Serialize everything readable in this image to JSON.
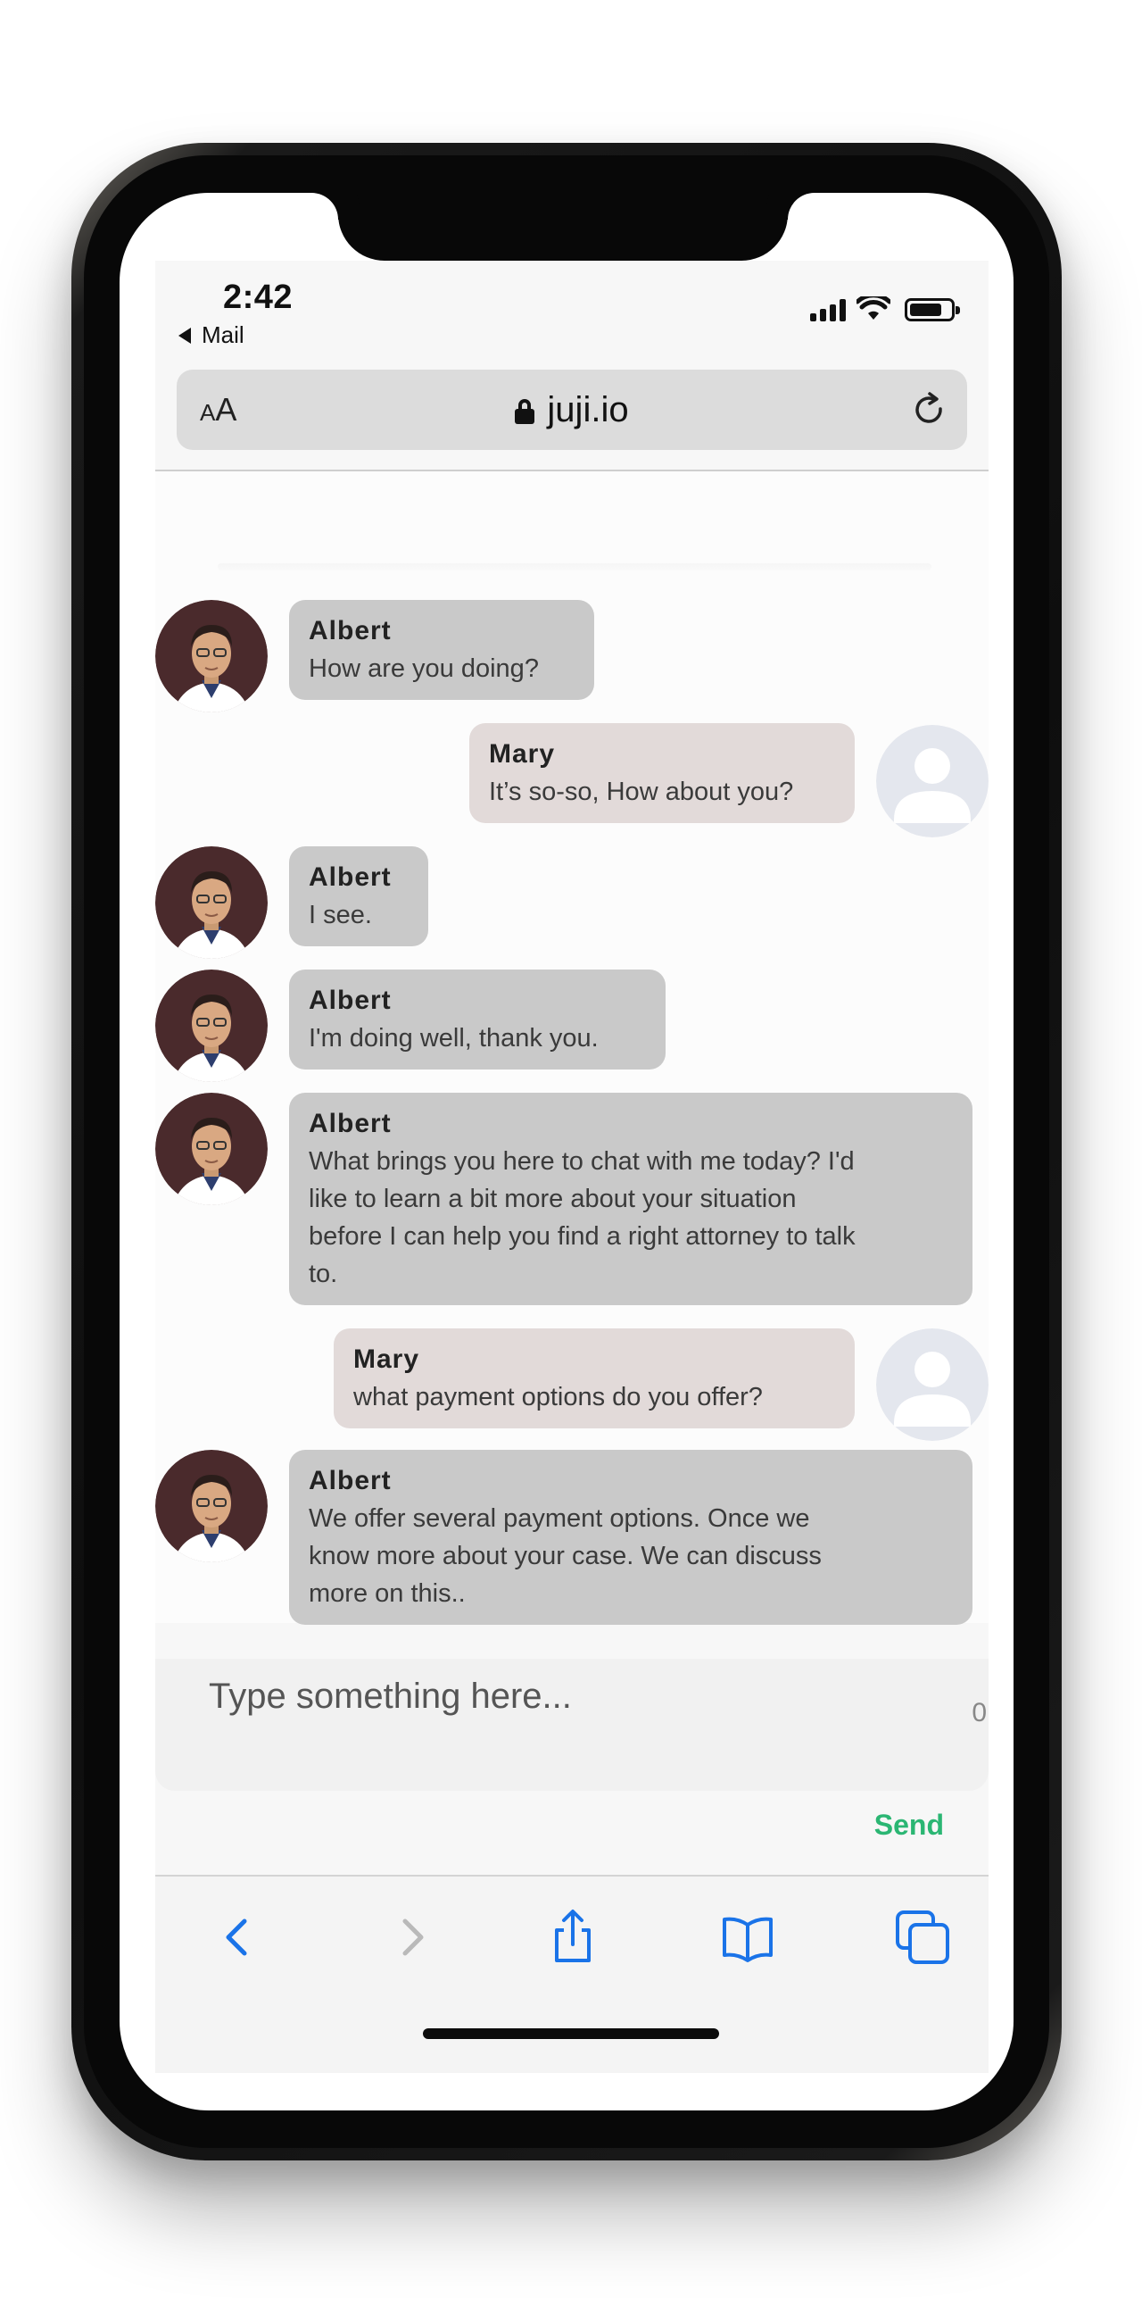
{
  "status_bar": {
    "time": "2:42",
    "back_label": "Mail"
  },
  "url_bar": {
    "text_size_label": "AA",
    "domain": "juji.io"
  },
  "messages": [
    {
      "sender": "Albert",
      "role": "bot",
      "text": "How are you doing?"
    },
    {
      "sender": "Mary",
      "role": "user",
      "text": "It’s so-so, How about you?"
    },
    {
      "sender": "Albert",
      "role": "bot",
      "text": "I see."
    },
    {
      "sender": "Albert",
      "role": "bot",
      "text": "I'm doing well, thank you."
    },
    {
      "sender": "Albert",
      "role": "bot",
      "lines": [
        "What brings you here to chat with me today? I'd",
        "like to learn a bit more about your situation",
        "before I can help you find a right attorney to talk",
        "to."
      ]
    },
    {
      "sender": "Mary",
      "role": "user",
      "text": "what payment options do you offer?"
    },
    {
      "sender": "Albert",
      "role": "bot",
      "lines": [
        "We offer several payment options. Once we",
        "know more about your case. We can discuss",
        "more on this.."
      ]
    }
  ],
  "composer": {
    "placeholder": "Type something here...",
    "char_count": "0",
    "send_label": "Send"
  },
  "toolbar": {
    "icons": [
      "back-icon",
      "forward-icon",
      "share-icon",
      "bookmarks-icon",
      "tabs-icon"
    ]
  },
  "colors": {
    "bot_bubble": "#c9c9c9",
    "user_bubble": "#e2dad9",
    "send": "#2bb673",
    "toolbar_icon": "#1a73e8",
    "disabled_icon": "#b9b9b9"
  }
}
